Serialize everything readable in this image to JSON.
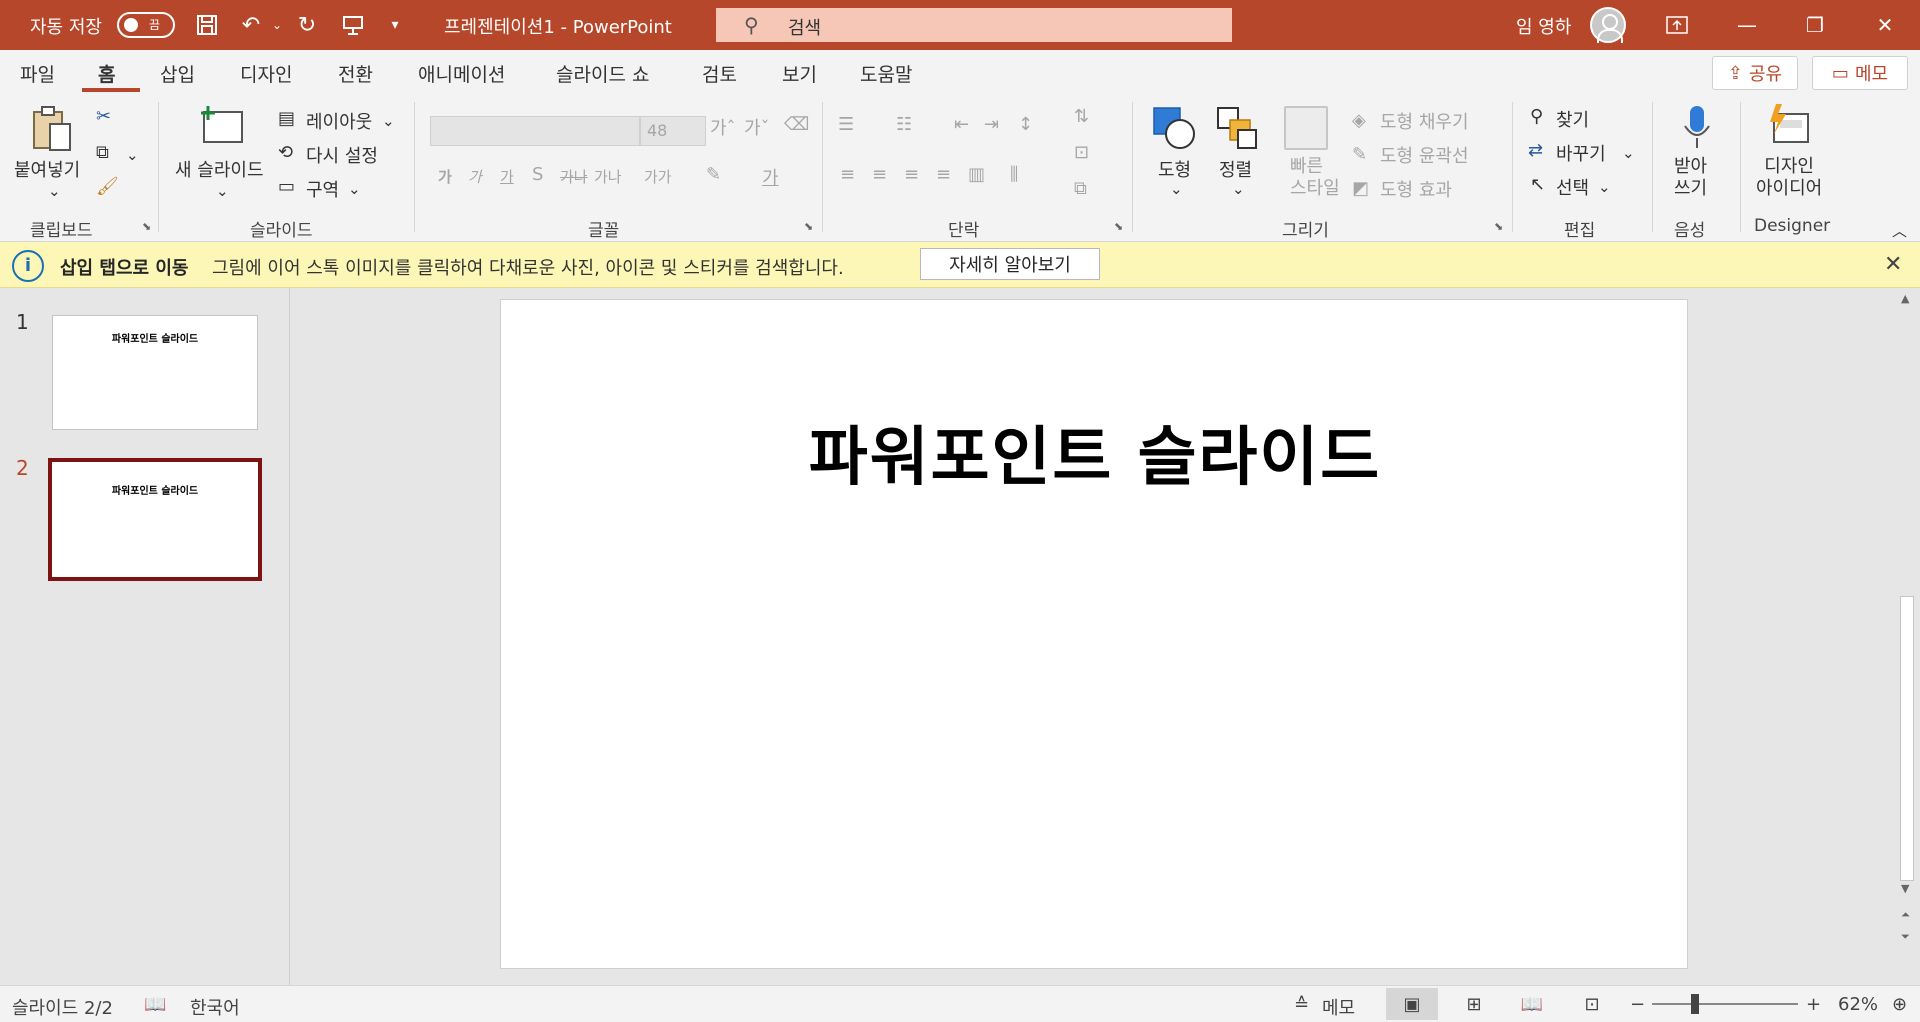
{
  "titlebar": {
    "autosave_label": "자동 저장",
    "autosave_state": "끔",
    "doc_title": "프레젠테이션1  -  PowerPoint",
    "search_placeholder": "검색",
    "user_name": "임 영하",
    "bg_color": "#b7472a"
  },
  "tabs": [
    {
      "label": "파일"
    },
    {
      "label": "홈"
    },
    {
      "label": "삽입"
    },
    {
      "label": "디자인"
    },
    {
      "label": "전환"
    },
    {
      "label": "애니메이션"
    },
    {
      "label": "슬라이드 쇼"
    },
    {
      "label": "검토"
    },
    {
      "label": "보기"
    },
    {
      "label": "도움말"
    }
  ],
  "active_tab": "홈",
  "share_label": "공유",
  "memo_label": "메모",
  "ribbon": {
    "clipboard": {
      "paste": "붙여넣기",
      "group": "클립보드"
    },
    "slides": {
      "new_slide": "새 슬라이드",
      "layout": "레이아웃",
      "reset": "다시 설정",
      "section": "구역",
      "group": "슬라이드"
    },
    "font": {
      "size": "48",
      "group": "글꼴",
      "bold": "가",
      "italic": "가",
      "underline": "가",
      "shadow": "S",
      "strike": "가나",
      "spacing": "가나",
      "case": "가가",
      "color": "가"
    },
    "paragraph": {
      "group": "단락"
    },
    "drawing": {
      "shape": "도형",
      "arrange": "정렬",
      "quick_styles": "빠른\n스타일",
      "fill": "도형 채우기",
      "outline": "도형 윤곽선",
      "effects": "도형 효과",
      "group": "그리기"
    },
    "editing": {
      "find": "찾기",
      "replace": "바꾸기",
      "select": "선택",
      "group": "편집"
    },
    "voice": {
      "dictate": "받아\n쓰기",
      "group": "음성"
    },
    "designer": {
      "ideas": "디자인\n아이디어",
      "group": "Designer"
    }
  },
  "infobar": {
    "title": "삽입 탭으로 이동",
    "message": "그림에 이어 스톡 이미지를 클릭하여 다채로운 사진, 아이콘 및 스티커를 검색합니다.",
    "button": "자세히 알아보기"
  },
  "thumbnails": [
    {
      "number": "1",
      "text": "파워포인트 슬라이드",
      "active": false
    },
    {
      "number": "2",
      "text": "파워포인트 슬라이드",
      "active": true
    }
  ],
  "slide": {
    "title": "파워포인트 슬라이드"
  },
  "statusbar": {
    "slide_counter": "슬라이드 2/2",
    "language": "한국어",
    "notes": "메모",
    "zoom": "62%"
  }
}
